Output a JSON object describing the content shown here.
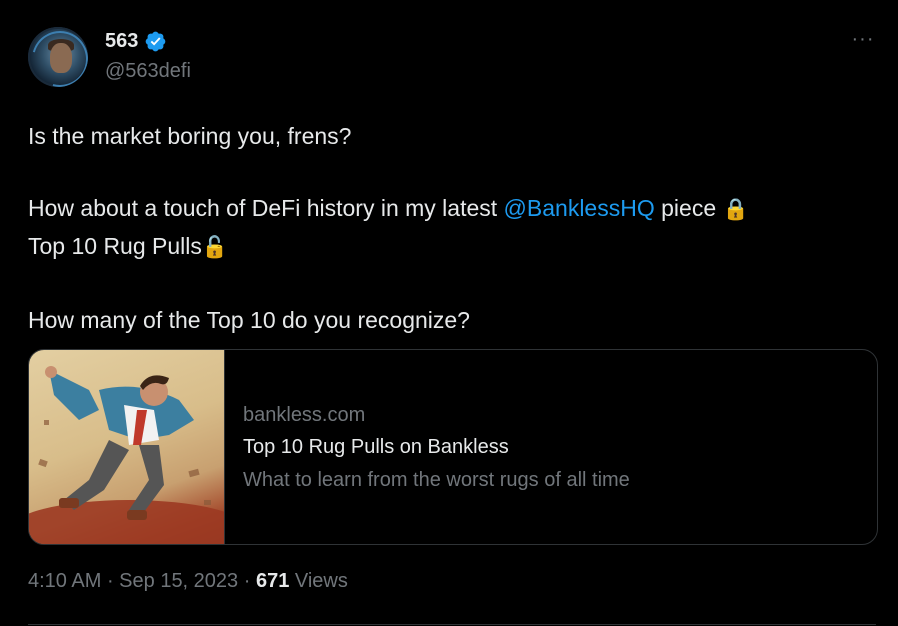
{
  "author": {
    "name": "563",
    "handle": "@563defi",
    "verified_color": "#1d9bf0"
  },
  "tweet": {
    "line1": "Is the market boring you, frens?",
    "line2_before": "How about a touch of DeFi history in my latest ",
    "line2_mention": "@BanklessHQ",
    "line2_after": " piece ",
    "lock_emoji": "🔒",
    "line3": "Top 10 Rug Pulls",
    "line3_emoji": "🔓",
    "line4": "How many of the Top 10 do you recognize?"
  },
  "card": {
    "domain": "bankless.com",
    "title": "Top 10 Rug Pulls on Bankless",
    "description": "What to learn from the worst rugs of all time"
  },
  "meta": {
    "time": "4:10 AM",
    "sep1": " · ",
    "date": "Sep 15, 2023",
    "sep2": " · ",
    "views_count": "671",
    "views_label": " Views"
  },
  "more_icon": "more-horizontal-icon",
  "colors": {
    "background": "#000000",
    "text": "#e7e9ea",
    "secondary": "#71767b",
    "accent": "#1d9bf0",
    "border": "#2f3336"
  }
}
